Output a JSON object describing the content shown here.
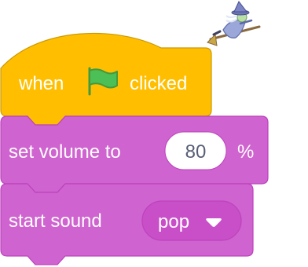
{
  "sprite": {
    "icon": "witch-sprite-icon"
  },
  "blocks": {
    "hat": {
      "word_before": "when",
      "icon": "green-flag-icon",
      "word_after": "clicked",
      "color": "#ffbf00",
      "border": "#cc9900"
    },
    "set_volume": {
      "label": "set volume to",
      "value": "80",
      "unit": "%",
      "color": "#cf63cf",
      "border": "#bd42bd"
    },
    "start_sound": {
      "label": "start sound",
      "sound": "pop",
      "dropdown_icon": "caret-down-icon",
      "color": "#cf63cf",
      "border": "#bd42bd"
    }
  }
}
